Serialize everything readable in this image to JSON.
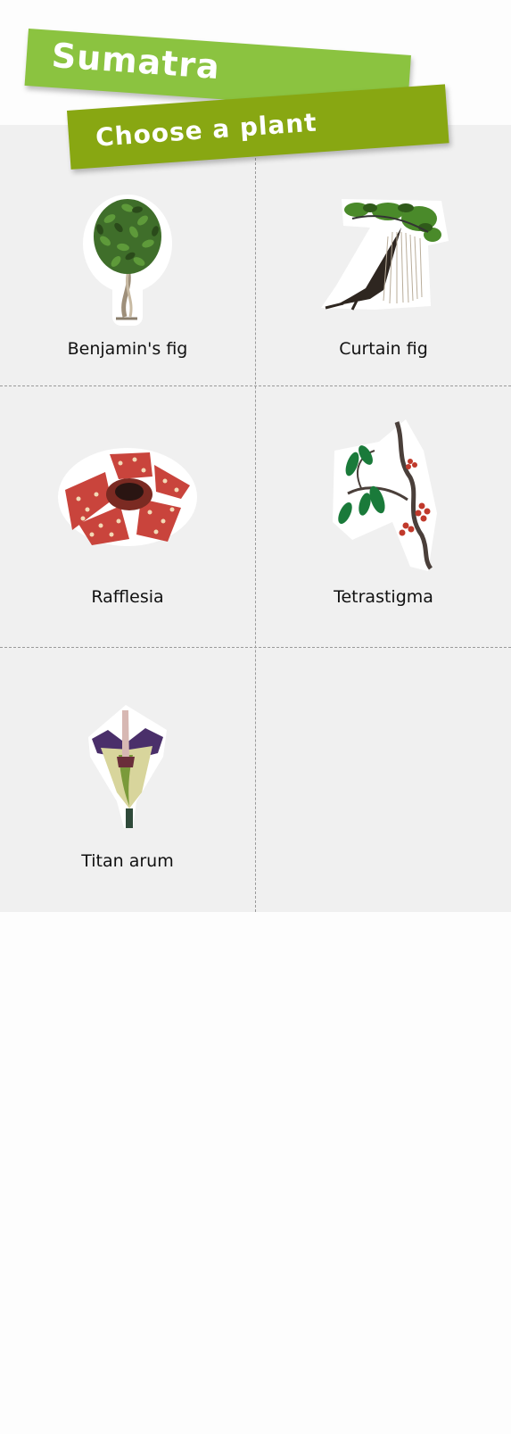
{
  "header": {
    "region_title": "Sumatra",
    "subtitle": "Choose a plant"
  },
  "plants": [
    {
      "label": "Benjamin's fig",
      "icon": "benjamins-fig-icon"
    },
    {
      "label": "Curtain fig",
      "icon": "curtain-fig-icon"
    },
    {
      "label": "Rafflesia",
      "icon": "rafflesia-icon"
    },
    {
      "label": "Tetrastigma",
      "icon": "tetrastigma-icon"
    },
    {
      "label": "Titan arum",
      "icon": "titan-arum-icon"
    }
  ],
  "colors": {
    "banner_primary": "#8bc340",
    "banner_secondary": "#88a712",
    "grid_background": "#f0f0f0"
  }
}
